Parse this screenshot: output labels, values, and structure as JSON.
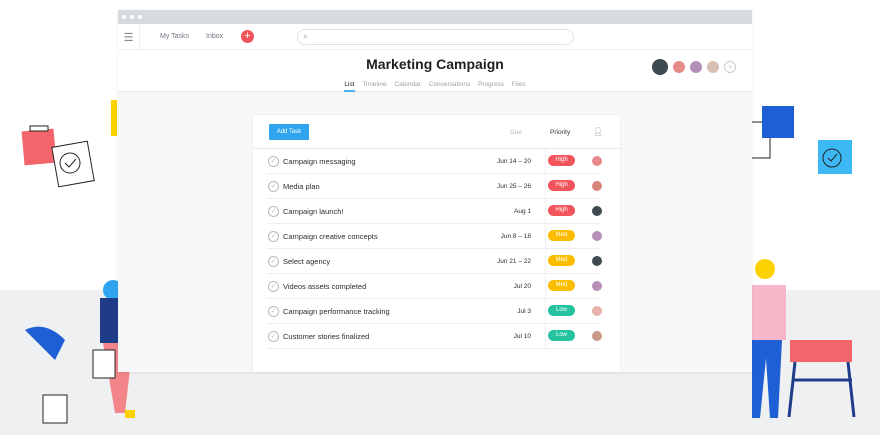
{
  "nav": {
    "my_tasks": "My Tasks",
    "inbox": "Inbox"
  },
  "header": {
    "title": "Marketing Campaign",
    "tabs": [
      "List",
      "Timeline",
      "Calendar",
      "Conversations",
      "Progress",
      "Files"
    ]
  },
  "toolbar": {
    "add_task": "Add Task"
  },
  "columns": {
    "due": "Due",
    "priority": "Priority"
  },
  "colors": {
    "high": "#f2545b",
    "med": "#fcbd01",
    "low": "#25c2a0",
    "accent": "#2fa5ef"
  },
  "tasks": [
    {
      "name": "Campaign messaging",
      "due": "Jun 14 – 20",
      "priority": "High"
    },
    {
      "name": "Media plan",
      "due": "Jun 25 – 26",
      "priority": "High"
    },
    {
      "name": "Campaign launch!",
      "due": "Aug 1",
      "priority": "High"
    },
    {
      "name": "Campaign creative concepts",
      "due": "Jun 8 – 18",
      "priority": "Med"
    },
    {
      "name": "Select agency",
      "due": "Jun 21 – 22",
      "priority": "Med"
    },
    {
      "name": "Videos assets completed",
      "due": "Jul 20",
      "priority": "Med"
    },
    {
      "name": "Campaign performance tracking",
      "due": "Jul 3",
      "priority": "Low"
    },
    {
      "name": "Customer stories finalized",
      "due": "Jul 10",
      "priority": "Low"
    }
  ]
}
